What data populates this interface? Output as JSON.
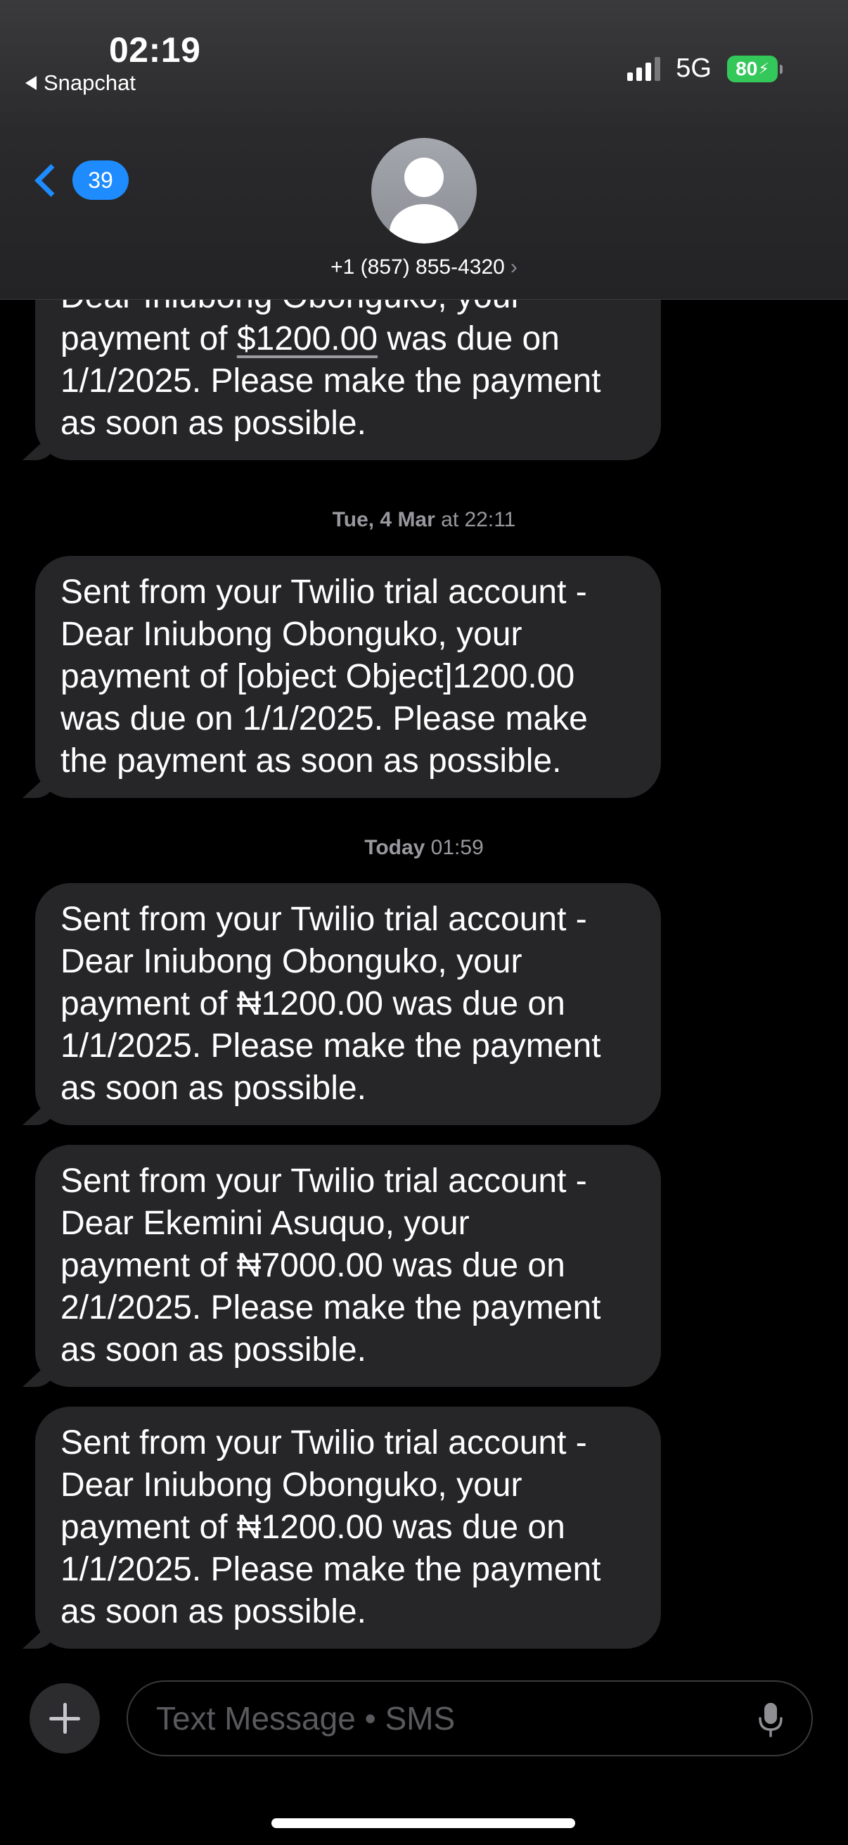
{
  "status_bar": {
    "time": "02:19",
    "back_app": "Snapchat",
    "network": "5G",
    "battery": "80"
  },
  "nav": {
    "unread_count": "39",
    "contact": "+1 (857) 855-4320",
    "contact_arrow": "›"
  },
  "messages": [
    {
      "lines": [
        "Dear Iniubong Obonguko, your",
        "payment of ",
        "$1200.00",
        " was due on",
        "1/1/2025. Please make the payment",
        "as soon as possible."
      ]
    },
    {
      "lines": [
        "Sent from your Twilio trial account -",
        "Dear Iniubong Obonguko, your",
        "payment of [object Object]1200.00",
        "was due on 1/1/2025. Please make",
        "the payment as soon as possible."
      ]
    },
    {
      "lines": [
        "Sent from your Twilio trial account -",
        "Dear Iniubong Obonguko, your",
        "payment of ₦1200.00 was due on",
        "1/1/2025. Please make the payment",
        "as soon as possible."
      ]
    },
    {
      "lines": [
        "Sent from your Twilio trial account -",
        "Dear Ekemini Asuquo, your",
        "payment of ₦7000.00 was due on",
        "2/1/2025. Please make the payment",
        "as soon as possible."
      ]
    },
    {
      "lines": [
        "Sent from your Twilio trial account -",
        "Dear Iniubong Obonguko, your",
        "payment of ₦1200.00 was due on",
        "1/1/2025. Please make the payment",
        "as soon as possible."
      ]
    }
  ],
  "timestamps": {
    "t1_day": "Tue, 4 Mar",
    "t1_rest": " at 22:11",
    "t2_day": "Today",
    "t2_rest": " 01:59"
  },
  "composer": {
    "placeholder": "Text Message • SMS"
  },
  "colors": {
    "accent": "#1e8cff",
    "bubble": "#262628",
    "battery": "#34c759"
  }
}
